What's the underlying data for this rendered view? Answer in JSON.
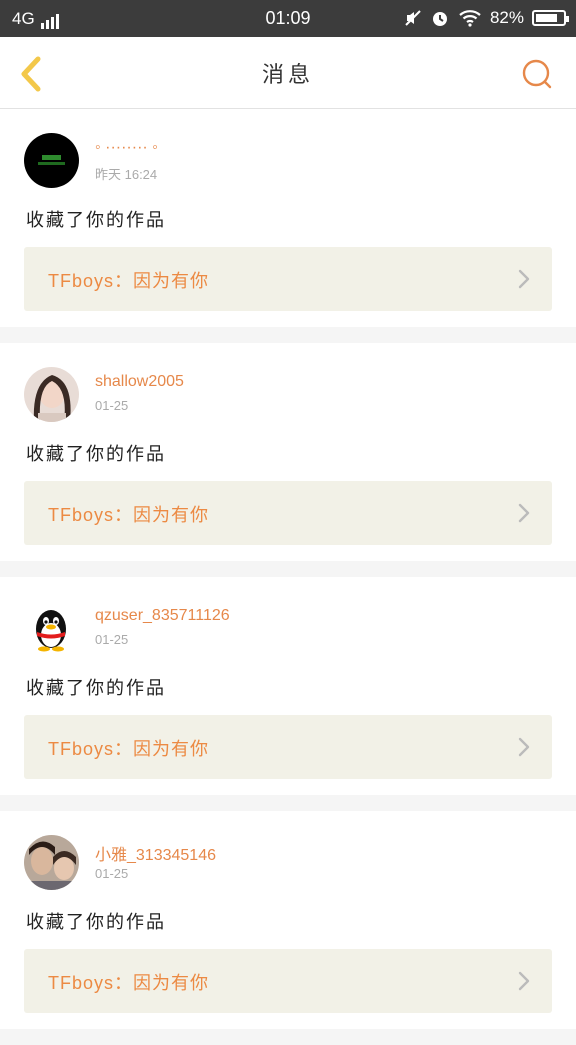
{
  "status_bar": {
    "network": "4G",
    "time": "01:09",
    "battery_text": "82%",
    "battery_level": 0.82
  },
  "header": {
    "title": "消息",
    "back_icon": "chevron-left-icon",
    "search_icon": "search-icon"
  },
  "colors": {
    "accent": "#e6884a",
    "back_icon": "#f3c84a",
    "card_link_bg": "#f2f1e7"
  },
  "messages": [
    {
      "username": "◦ ········ ◦",
      "time": "昨天 16:24",
      "action": "收藏了你的作品",
      "work": "TFboys：因为有你",
      "avatar": "dark-avatar"
    },
    {
      "username": "shallow2005",
      "time": "01-25",
      "action": "收藏了你的作品",
      "work": "TFboys：因为有你",
      "avatar": "girl-photo-avatar"
    },
    {
      "username": "qzuser_835711126",
      "time": "01-25",
      "action": "收藏了你的作品",
      "work": "TFboys：因为有你",
      "avatar": "penguin-avatar"
    },
    {
      "username": "小雅_313345146",
      "time": "01-25",
      "action": "收藏了你的作品",
      "work": "TFboys：因为有你",
      "avatar": "selfie-avatar"
    }
  ]
}
